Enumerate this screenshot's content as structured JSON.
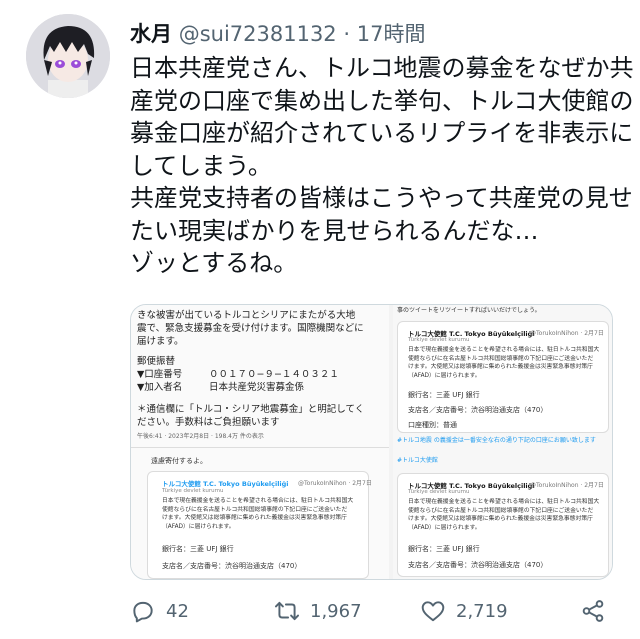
{
  "tweet": {
    "display_name": "水月",
    "handle": "@sui72381132",
    "separator": "·",
    "time": "17時間",
    "text": "日本共産党さん、トルコ地震の募金をなぜか共産党の口座で集め出した挙句、トルコ大使館の募金口座が紹介されているリプライを非表示にしてしまう。\n共産党支持者の皆様はこうやって共産党の見せたい現実ばかりを見せられるんだな…\nゾッとするね。"
  },
  "media": {
    "left": {
      "intro1": "きな被害が出ているトルコとシリアにまたがる大地",
      "intro2": "震で、緊急支援募金を受け付けます。国際機関などに",
      "intro3": "届けます。",
      "transfer": "郵便振替",
      "account_label": "▼口座番号",
      "account_number": "００１７０−９−１４０３２１",
      "name_label": "▼加入者名",
      "name_value": "日本共産党災害募金係",
      "note1": "＊通信欄に「トルコ・シリア地震募金」と明記してく",
      "note2": "ださい。手数料はご負担願います",
      "meta": "午後6:41 · 2023年2月8日 · 198.4万 件の表示",
      "reply_note": "遠慮寄付するよ。"
    },
    "card": {
      "name": "トルコ大使館 T.C. Tokyo Büyükelçiliği",
      "handle": "@TorukoInNihon · 2月7日",
      "sub": "Türkiye devlet kurumu",
      "body": "日本で現在義援金を送ることを希望される場合には、駐日トルコ共和国大\n使館ならびに在名古屋トルコ共和国総領事館の下記口座にご送金いただ\nけます。大使館又は総領事館に集められた義援金は災害緊急事態対策庁\n（AFAD）に届けられます。",
      "bank": "銀行名：三菱 UFJ 銀行",
      "branch": "支店名／支店番号：渋谷明治通支店（470）",
      "account_type": "口座種別：普通"
    },
    "right": {
      "top": "事のツイートをリツイートすればいいだけでしょう。",
      "hashtag": "#トルコ大使館",
      "notice": "#トルコ地震 の義援金は一番安全な右の通り下記の口座にお願い致します"
    }
  },
  "actions": {
    "replies": "42",
    "retweets": "1,967",
    "likes": "2,719"
  },
  "colors": {
    "text": "#0f1419",
    "muted": "#536471",
    "accent": "#1d9bf0"
  }
}
